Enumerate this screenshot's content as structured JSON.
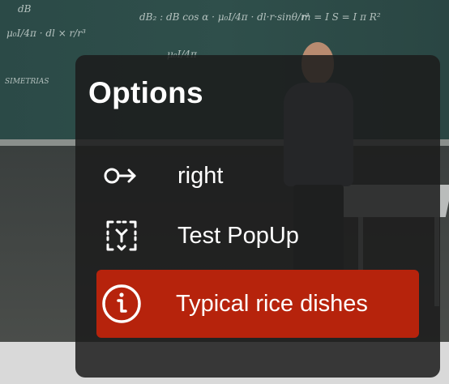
{
  "panel": {
    "title": "Options",
    "items": [
      {
        "label": "right",
        "icon": "arrow-right-circle-icon",
        "selected": false
      },
      {
        "label": "Test PopUp",
        "icon": "focus-frame-icon",
        "selected": false
      },
      {
        "label": "Typical rice dishes",
        "icon": "info-icon",
        "selected": true
      }
    ]
  },
  "colors": {
    "panel_bg": "#1c1c1c",
    "selected_bg": "#b6230c",
    "text": "#ffffff"
  }
}
